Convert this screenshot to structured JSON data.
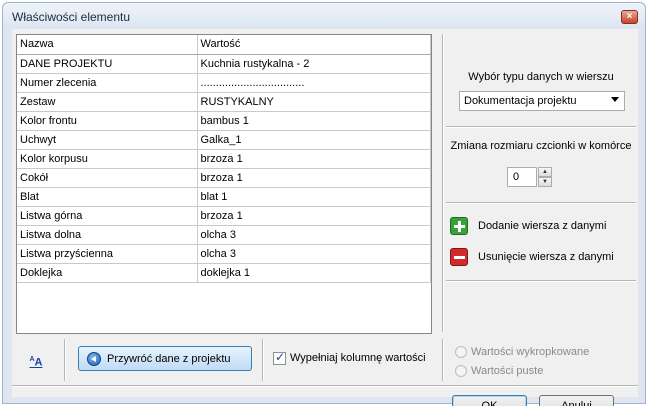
{
  "window": {
    "title": "Właściwości elementu",
    "close_glyph": "×"
  },
  "grid": {
    "headers": [
      "Nazwa",
      "Wartość"
    ],
    "rows": [
      [
        "DANE PROJEKTU",
        "Kuchnia rustykalna - 2"
      ],
      [
        "Numer zlecenia",
        ".................................."
      ],
      [
        "Zestaw",
        "RUSTYKALNY"
      ],
      [
        "Kolor frontu",
        "bambus 1"
      ],
      [
        "Uchwyt",
        "Galka_1"
      ],
      [
        "Kolor korpusu",
        "brzoza 1"
      ],
      [
        "Cokół",
        "brzoza 1"
      ],
      [
        "Blat",
        "blat 1"
      ],
      [
        "Listwa górna",
        "brzoza 1"
      ],
      [
        "Listwa dolna",
        "olcha 3"
      ],
      [
        "Listwa przyścienna",
        "olcha 3"
      ],
      [
        "Doklejka",
        "doklejka 1"
      ]
    ]
  },
  "panel": {
    "type_label": "Wybór typu danych w wierszu",
    "type_value": "Dokumentacja projektu",
    "font_label": "Zmiana rozmiaru czcionki w komórce",
    "font_size": "0",
    "add_row": "Dodanie wiersza z danymi",
    "remove_row": "Usunięcie wiersza z danymi"
  },
  "bottom": {
    "font_button": "A",
    "restore_button": "Przywróć dane z projektu",
    "fill_checkbox": "Wypełniaj kolumnę wartości",
    "radio_dotted": "Wartości wykropkowane",
    "radio_empty": "Wartości puste"
  },
  "buttons": {
    "ok": "OK",
    "cancel": "Anuluj"
  }
}
